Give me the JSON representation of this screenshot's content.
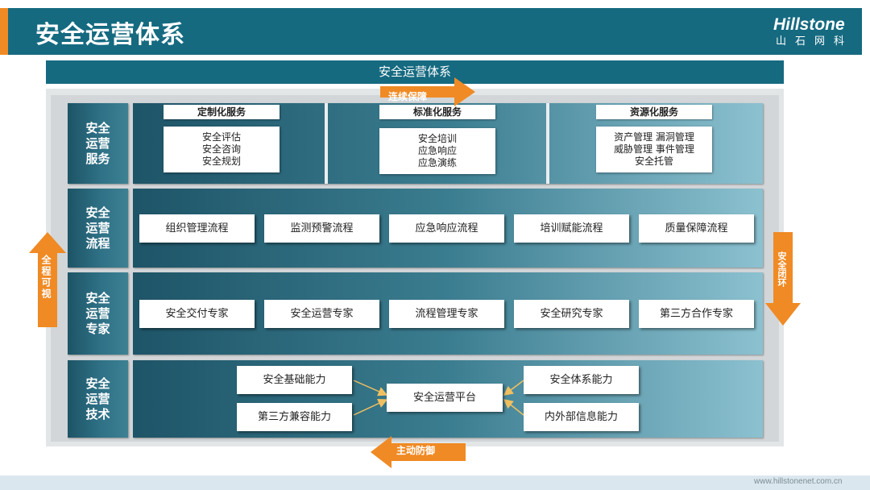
{
  "header": {
    "title": "安全运营体系",
    "logo_main": "Hillstone",
    "logo_sub": "山石网科"
  },
  "banner": "安全运营体系",
  "arrows": {
    "top": "连续保障",
    "bottom": "主动防御",
    "left": "全程可视",
    "right": "安全闭环"
  },
  "rows": {
    "services": {
      "label_lines": [
        "安全",
        "运营",
        "服务"
      ]
    },
    "process": {
      "label_lines": [
        "安全",
        "运营",
        "流程"
      ]
    },
    "experts": {
      "label_lines": [
        "安全",
        "运营",
        "专家"
      ]
    },
    "tech": {
      "label_lines": [
        "安全",
        "运营",
        "技术"
      ]
    }
  },
  "services": [
    {
      "title": "定制化服务",
      "items": [
        "安全评估",
        "安全咨询",
        "安全规划"
      ]
    },
    {
      "title": "标准化服务",
      "items": [
        "安全培训",
        "应急响应",
        "应急演练"
      ]
    },
    {
      "title": "资源化服务",
      "items": [
        "资产管理 漏洞管理",
        "威胁管理 事件管理",
        "安全托管"
      ]
    }
  ],
  "processes": [
    "组织管理流程",
    "监测预警流程",
    "应急响应流程",
    "培训赋能流程",
    "质量保障流程"
  ],
  "experts": [
    "安全交付专家",
    "安全运营专家",
    "流程管理专家",
    "安全研究专家",
    "第三方合作专家"
  ],
  "tech": {
    "center": "安全运营平台",
    "left_top": "安全基础能力",
    "left_bottom": "第三方兼容能力",
    "right_top": "安全体系能力",
    "right_bottom": "内外部信息能力"
  },
  "footer": {
    "url": "www.hillstonenet.com.cn"
  },
  "colors": {
    "teal": "#156a80",
    "orange": "#f08a24"
  }
}
